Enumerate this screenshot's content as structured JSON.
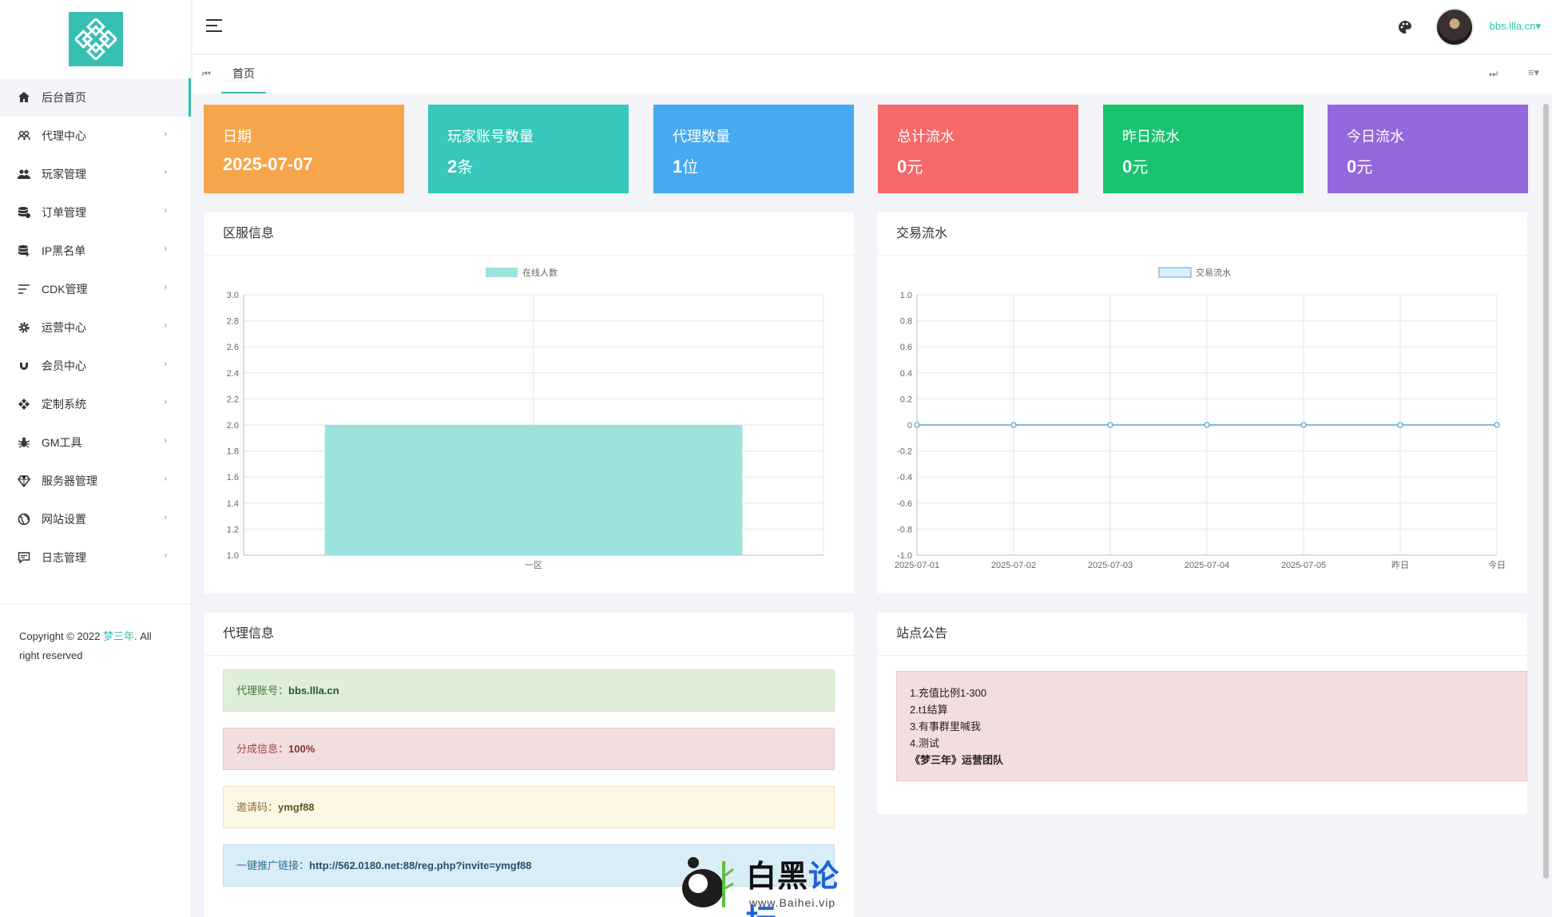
{
  "sidebar": {
    "items": [
      {
        "label": "后台首页",
        "icon": "home-icon",
        "active": true,
        "has_children": false
      },
      {
        "label": "代理中心",
        "icon": "users-outline-icon",
        "has_children": true
      },
      {
        "label": "玩家管理",
        "icon": "users-icon",
        "has_children": true
      },
      {
        "label": "订单管理",
        "icon": "database-icon",
        "has_children": true
      },
      {
        "label": "IP黑名单",
        "icon": "database-add-icon",
        "has_children": true
      },
      {
        "label": "CDK管理",
        "icon": "sort-lines-icon",
        "has_children": true
      },
      {
        "label": "运营中心",
        "icon": "gear-icon",
        "has_children": true
      },
      {
        "label": "会员中心",
        "icon": "magnet-icon",
        "has_children": true
      },
      {
        "label": "定制系统",
        "icon": "diamond-cluster-icon",
        "has_children": true
      },
      {
        "label": "GM工具",
        "icon": "bug-icon",
        "has_children": true
      },
      {
        "label": "服务器管理",
        "icon": "gem-icon",
        "has_children": true
      },
      {
        "label": "网站设置",
        "icon": "globe-icon",
        "has_children": true
      },
      {
        "label": "日志管理",
        "icon": "message-icon",
        "has_children": true
      }
    ],
    "arrow": "›",
    "copyright_prefix": "Copyright © 2022 ",
    "copyright_brand": "梦三年",
    "copyright_suffix": ". All right reserved"
  },
  "header": {
    "username": "bbs.llla.cn",
    "caret": "▾"
  },
  "tabs": {
    "prev_icon": "⏮",
    "home": "首页",
    "next_icon": "⏭",
    "menu_icon": "≡▾"
  },
  "stats": [
    {
      "label": "日期",
      "value": "2025-07-07",
      "unit": "",
      "color": "#f7a54a"
    },
    {
      "label": "玩家账号数量",
      "value": "2",
      "unit": "条",
      "color": "#35c8bb"
    },
    {
      "label": "代理数量",
      "value": "1",
      "unit": "位",
      "color": "#45aaf2"
    },
    {
      "label": "总计流水",
      "value": "0",
      "unit": "元",
      "color": "#f6696a"
    },
    {
      "label": "昨日流水",
      "value": "0",
      "unit": "元",
      "color": "#19c46f"
    },
    {
      "label": "今日流水",
      "value": "0",
      "unit": "元",
      "color": "#9468dc"
    }
  ],
  "panels": {
    "server_title": "区服信息",
    "flow_title": "交易流水",
    "agent_title": "代理信息",
    "notice_title": "站点公告"
  },
  "chart_data": [
    {
      "type": "bar",
      "categories": [
        "一区"
      ],
      "series": [
        {
          "name": "在线人数",
          "values": [
            2
          ],
          "color": "#9be3dc"
        }
      ],
      "ylim": [
        1.0,
        3.0
      ],
      "yticks": [
        "1.0",
        "1.2",
        "1.4",
        "1.6",
        "1.8",
        "2.0",
        "2.2",
        "2.4",
        "2.6",
        "2.8",
        "3.0"
      ],
      "legend": "top-center",
      "grid": true
    },
    {
      "type": "line",
      "categories": [
        "2025-07-01",
        "2025-07-02",
        "2025-07-03",
        "2025-07-04",
        "2025-07-05",
        "昨日",
        "今日"
      ],
      "series": [
        {
          "name": "交易流水",
          "values": [
            0,
            0,
            0,
            0,
            0,
            0,
            0
          ],
          "color": "#5aa5d6"
        }
      ],
      "ylim": [
        -1.0,
        1.0
      ],
      "yticks": [
        "-1.0",
        "-0.8",
        "-0.6",
        "-0.4",
        "-0.2",
        "0",
        "0.2",
        "0.4",
        "0.6",
        "0.8",
        "1.0"
      ],
      "legend": "top-center",
      "grid": true
    }
  ],
  "agent": {
    "account_label": "代理账号：",
    "account_value": "bbs.llla.cn",
    "share_label": "分成信息：",
    "share_value": "100%",
    "invite_label": "邀请码：",
    "invite_value": "ymgf88",
    "link_label": "一键推广链接：",
    "link_value": "http://562.0180.net:88/reg.php?invite=ymgf88"
  },
  "notice": {
    "lines": [
      "1.充值比例1-300",
      "2.t1结算",
      "3.有事群里喊我",
      "4.测试"
    ],
    "signature": "《梦三年》运营团队"
  },
  "watermark": {
    "title_a": "白黑",
    "title_b": "论坛",
    "url": "www.Baihei.vip"
  }
}
